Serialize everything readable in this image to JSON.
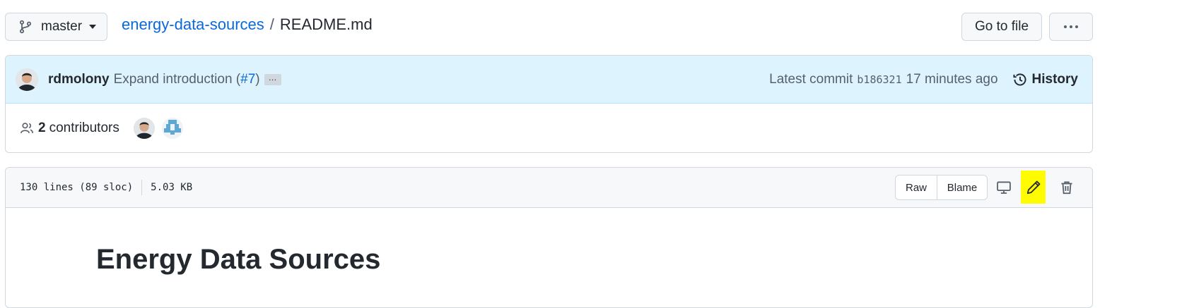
{
  "branch": {
    "name": "master"
  },
  "breadcrumb": {
    "repo": "energy-data-sources",
    "separator": "/",
    "file": "README.md"
  },
  "toolbar": {
    "goto_file_label": "Go to file",
    "more_label": "···"
  },
  "commit": {
    "author": "rdmolony",
    "message": "Expand introduction (",
    "pr_link": "#7",
    "message_end": ")",
    "ellipsis": "…",
    "latest_label": "Latest commit",
    "sha": "b186321",
    "time_ago": "17 minutes ago",
    "history_label": "History"
  },
  "contributors": {
    "count": "2",
    "label": "contributors"
  },
  "file": {
    "lines_info": "130 lines (89 sloc)",
    "size": "5.03 KB",
    "raw_label": "Raw",
    "blame_label": "Blame"
  },
  "readme": {
    "title": "Energy Data Sources"
  },
  "colors": {
    "accent": "#0969da",
    "commit_bg": "#ddf4ff",
    "highlight": "#fffb00"
  }
}
